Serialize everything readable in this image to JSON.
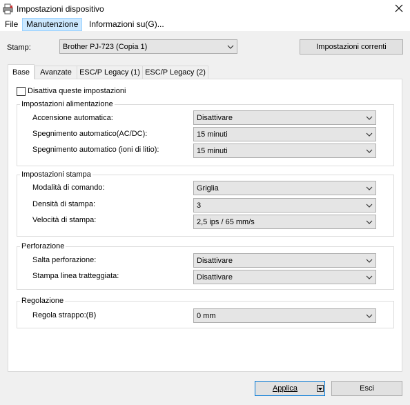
{
  "window": {
    "title": "Impostazioni dispositivo",
    "close_label": "✕"
  },
  "menu": [
    {
      "label": "File"
    },
    {
      "label": "Manutenzione"
    },
    {
      "label": "Informazioni su(G)..."
    }
  ],
  "printer": {
    "label": "Stamp:",
    "selected": "Brother PJ-723 (Copia 1)",
    "current_settings_label": "Impostazioni correnti"
  },
  "tabs": [
    {
      "label": "Base"
    },
    {
      "label": "Avanzate"
    },
    {
      "label": "ESC/P Legacy (1)"
    },
    {
      "label": "ESC/P Legacy (2)"
    }
  ],
  "disable_settings": {
    "label": "Disattiva queste impostazioni",
    "checked": false
  },
  "groups": {
    "power": {
      "title": "Impostazioni alimentazione",
      "fields": [
        {
          "label": "Accensione automatica:",
          "value": "Disattivare"
        },
        {
          "label": "Spegnimento automatico(AC/DC):",
          "value": "15 minuti"
        },
        {
          "label": "Spegnimento automatico (ioni di litio):",
          "value": "15 minuti"
        }
      ]
    },
    "print": {
      "title": "Impostazioni stampa",
      "fields": [
        {
          "label": "Modalità di comando:",
          "value": "Griglia"
        },
        {
          "label": "Densità di stampa:",
          "value": "3"
        },
        {
          "label": "Velocità di stampa:",
          "value": "2,5 ips / 65 mm/s"
        }
      ]
    },
    "perforation": {
      "title": "Perforazione",
      "fields": [
        {
          "label": "Salta perforazione:",
          "value": "Disattivare"
        },
        {
          "label": "Stampa linea tratteggiata:",
          "value": "Disattivare"
        }
      ]
    },
    "adjust": {
      "title": "Regolazione",
      "fields": [
        {
          "label": "Regola strappo:(B)",
          "value": "0 mm"
        }
      ]
    }
  },
  "footer": {
    "apply_label": "Applica",
    "exit_label": "Esci"
  }
}
